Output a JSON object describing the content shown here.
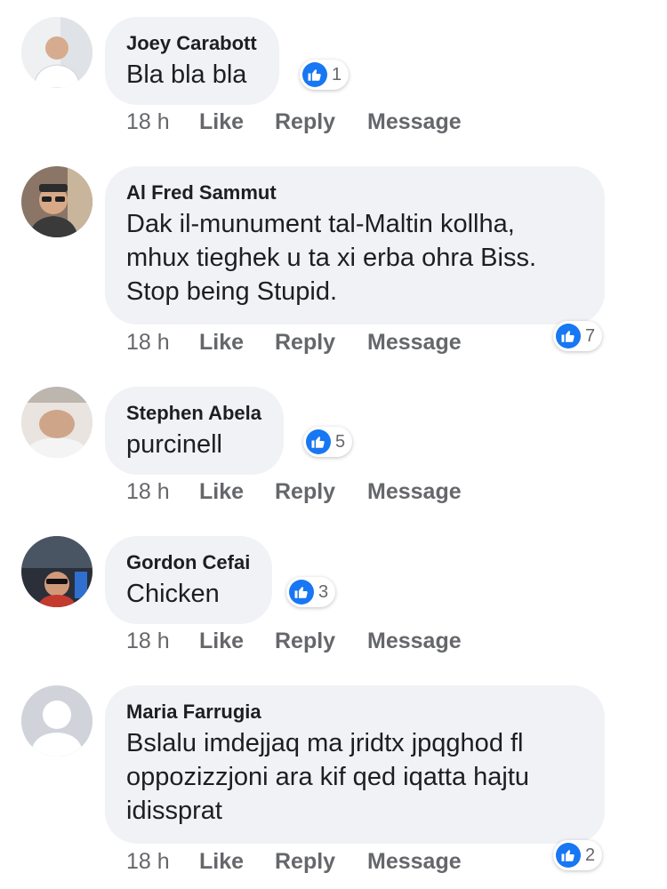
{
  "comments": [
    {
      "name": "Joey Carabott",
      "text": "Bla bla bla",
      "time": "18 h",
      "like": "Like",
      "reply": "Reply",
      "message": "Message",
      "reactions": "1",
      "avatar": "profile-photo"
    },
    {
      "name": "Al Fred Sammut",
      "text": "Dak il-munument tal-Maltin kollha, mhux tieghek u ta xi erba ohra Biss. Stop being Stupid.",
      "time": "18 h",
      "like": "Like",
      "reply": "Reply",
      "message": "Message",
      "reactions": "7",
      "avatar": "profile-photo"
    },
    {
      "name": "Stephen Abela",
      "text": "purcinell",
      "time": "18 h",
      "like": "Like",
      "reply": "Reply",
      "message": "Message",
      "reactions": "5",
      "avatar": "profile-photo"
    },
    {
      "name": "Gordon Cefai",
      "text": "Chicken",
      "time": "18 h",
      "like": "Like",
      "reply": "Reply",
      "message": "Message",
      "reactions": "3",
      "avatar": "profile-photo"
    },
    {
      "name": "Maria Farrugia",
      "text": "Bslalu imdejjaq ma jridtx jpqghod fl oppozizzjoni ara kif qed iqatta hajtu idissprat",
      "time": "18 h",
      "like": "Like",
      "reply": "Reply",
      "message": "Message",
      "reactions": "2",
      "avatar": "default-silhouette"
    }
  ],
  "colors": {
    "bubble": "#f0f2f5",
    "like_blue": "#1877f2",
    "meta_gray": "#65676b",
    "text": "#1c1e21"
  }
}
